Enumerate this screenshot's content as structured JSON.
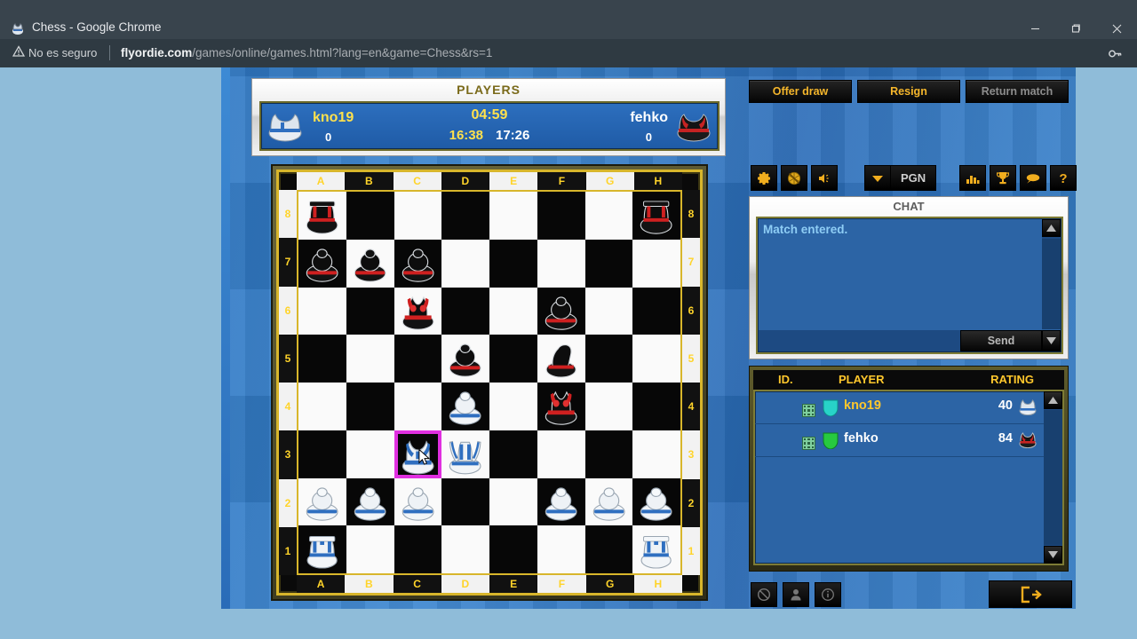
{
  "browser": {
    "tab_title": "Chess - Google Chrome",
    "favicon_name": "chess-king-favicon",
    "security_label": "No es seguro",
    "url_domain": "flyordie.com",
    "url_path": "/games/online/games.html?lang=en&game=Chess&rs=1",
    "key_icon": "key-icon",
    "window_controls": {
      "minimize": "minimize-icon",
      "maximize": "maximize-icon",
      "close": "close-icon"
    }
  },
  "players_panel": {
    "title": "PLAYERS",
    "white": {
      "name": "kno19",
      "score": "0",
      "clock": "16:38",
      "piece_icon": "white-king-icon"
    },
    "black": {
      "name": "fehko",
      "score": "0",
      "clock": "17:26",
      "piece_icon": "black-king-icon"
    },
    "turn_timer": "04:59"
  },
  "actions": {
    "offer_draw": "Offer draw",
    "resign": "Resign",
    "return_match": "Return match"
  },
  "toolbar_icons": [
    {
      "name": "settings-gear-icon"
    },
    {
      "name": "mute-ball-icon"
    },
    {
      "name": "speaker-icon"
    },
    {
      "name": "pgn-dropdown-arrow-icon"
    },
    {
      "name": "bar-chart-icon"
    },
    {
      "name": "trophy-icon"
    },
    {
      "name": "chat-bubble-icon"
    },
    {
      "name": "help-question-icon"
    }
  ],
  "pgn_label": "PGN",
  "chat": {
    "title": "CHAT",
    "messages": [
      "Match entered."
    ],
    "input_value": "",
    "input_placeholder": "",
    "send_label": "Send",
    "scroll_up_icon": "scroll-up-arrow-icon",
    "scroll_down_icon": "scroll-down-arrow-icon"
  },
  "player_list": {
    "columns": {
      "id": "ID.",
      "player": "PLAYER",
      "rating": "RATING"
    },
    "rows": [
      {
        "name": "kno19",
        "rating": "40",
        "shield_color": "#28d3c8",
        "name_color": "gold",
        "piece_icon": "white-king-icon"
      },
      {
        "name": "fehko",
        "rating": "84",
        "shield_color": "#27c93f",
        "name_color": "white",
        "piece_icon": "black-king-icon"
      }
    ]
  },
  "bottom_bar": {
    "buttons": [
      {
        "name": "block-user-icon"
      },
      {
        "name": "profile-user-icon"
      },
      {
        "name": "info-icon"
      }
    ],
    "exit_icon": "exit-door-icon"
  },
  "board": {
    "files": [
      "A",
      "B",
      "C",
      "D",
      "E",
      "F",
      "G",
      "H"
    ],
    "ranks": [
      "8",
      "7",
      "6",
      "5",
      "4",
      "3",
      "2",
      "1"
    ],
    "selected_square": "c3",
    "cursor_square": "c3",
    "selection_color": "#e02fe0",
    "position": [
      [
        "br",
        "",
        "",
        "",
        "",
        "",
        "",
        "br"
      ],
      [
        "bp",
        "bp",
        "bp",
        "",
        "",
        "",
        "",
        ""
      ],
      [
        "",
        "",
        "bq",
        "",
        "",
        "bp",
        "",
        ""
      ],
      [
        "",
        "",
        "",
        "bp",
        "",
        "bn",
        "",
        ""
      ],
      [
        "",
        "",
        "",
        "wp",
        "",
        "bq",
        "",
        ""
      ],
      [
        "",
        "",
        "wk",
        "wq",
        "",
        "",
        "",
        ""
      ],
      [
        "wp",
        "wp",
        "wp",
        "",
        "",
        "wp",
        "wp",
        "wp"
      ],
      [
        "wr",
        "",
        "",
        "",
        "",
        "",
        "",
        "wr"
      ]
    ]
  }
}
